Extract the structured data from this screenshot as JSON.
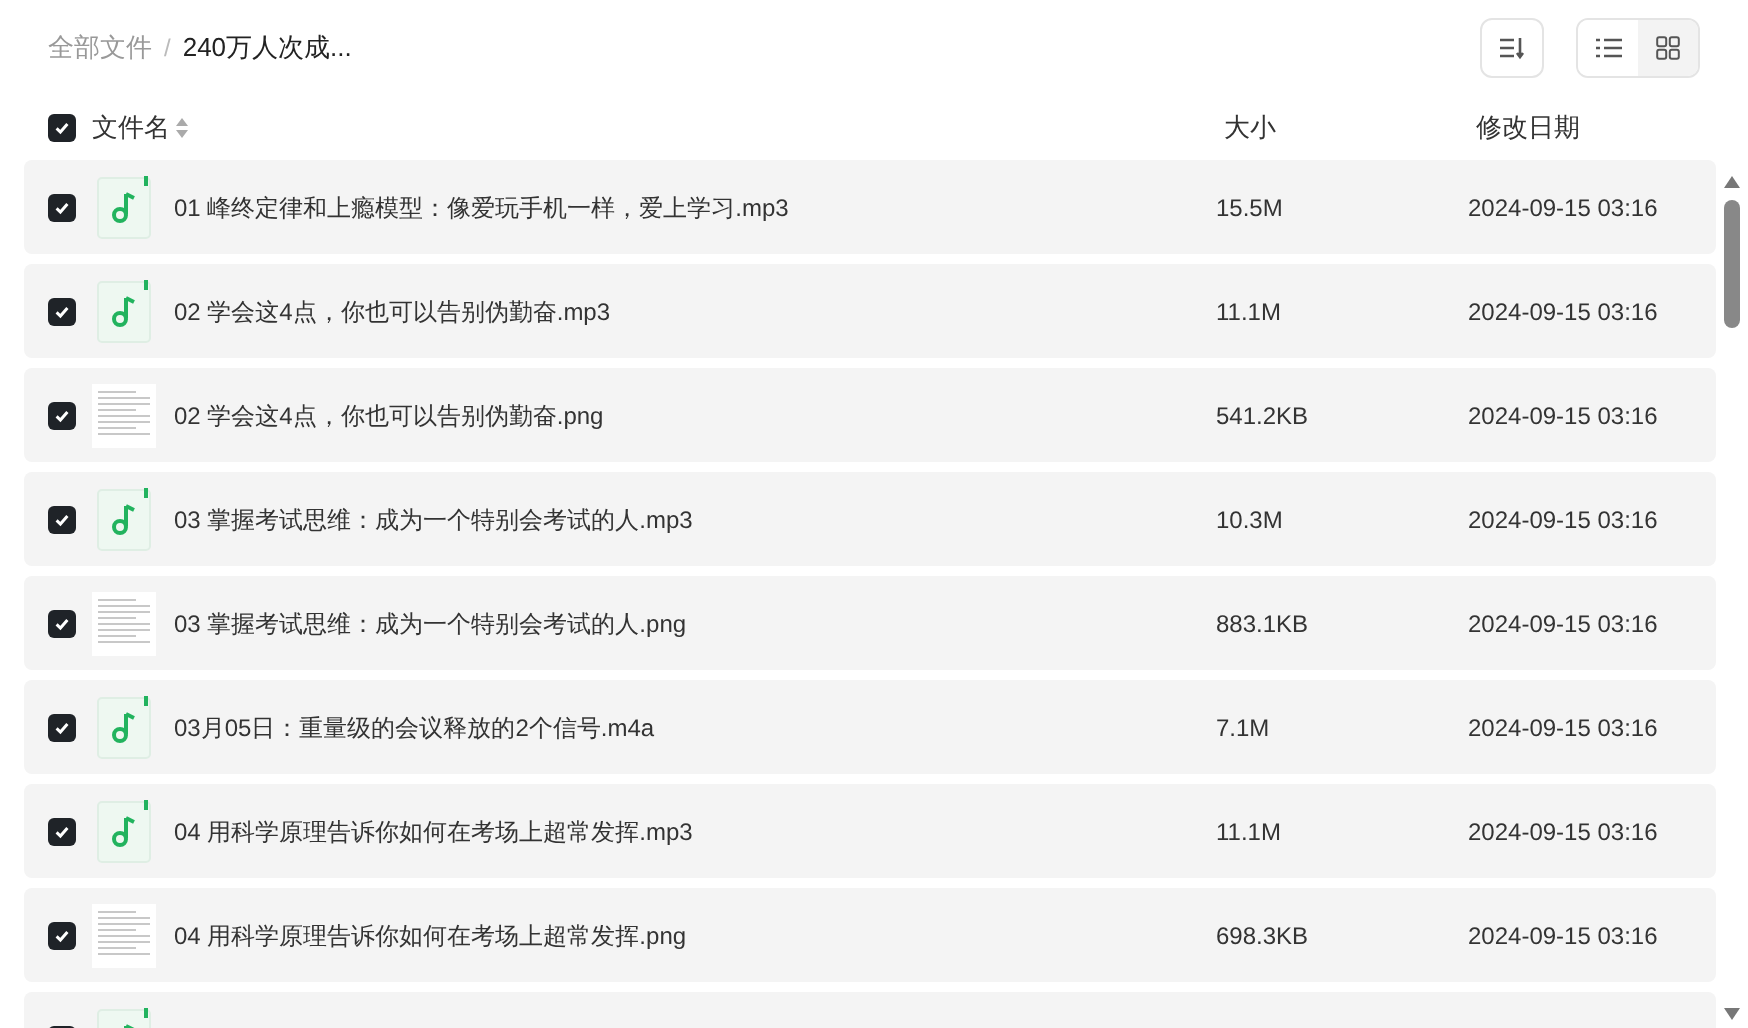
{
  "breadcrumb_separator": "/",
  "breadcrumb": [
    {
      "label": "全部文件",
      "current": false
    },
    {
      "label": "240万人次成...",
      "current": true
    }
  ],
  "view_toggle": [
    {
      "kind": "list",
      "selected": true
    },
    {
      "kind": "grid",
      "selected": false
    }
  ],
  "header": {
    "checked": true,
    "name": "文件名",
    "size": "大小",
    "date": "修改日期"
  },
  "rows": [
    {
      "kind": "audio",
      "checked": true,
      "name": "01 峰终定律和上瘾模型：像爱玩手机一样，爱上学习.mp3",
      "size": "15.5M",
      "date": "2024-09-15 03:16"
    },
    {
      "kind": "audio",
      "checked": true,
      "name": "02 学会这4点，你也可以告别伪勤奋.mp3",
      "size": "11.1M",
      "date": "2024-09-15 03:16"
    },
    {
      "kind": "image",
      "checked": true,
      "name": "02 学会这4点，你也可以告别伪勤奋.png",
      "size": "541.2KB",
      "date": "2024-09-15 03:16"
    },
    {
      "kind": "audio",
      "checked": true,
      "name": "03 掌握考试思维：成为一个特别会考试的人.mp3",
      "size": "10.3M",
      "date": "2024-09-15 03:16"
    },
    {
      "kind": "image",
      "checked": true,
      "name": "03 掌握考试思维：成为一个特别会考试的人.png",
      "size": "883.1KB",
      "date": "2024-09-15 03:16"
    },
    {
      "kind": "audio",
      "checked": true,
      "name": "03月05日：重量级的会议释放的2个信号.m4a",
      "size": "7.1M",
      "date": "2024-09-15 03:16"
    },
    {
      "kind": "audio",
      "checked": true,
      "name": "04 用科学原理告诉你如何在考场上超常发挥.mp3",
      "size": "11.1M",
      "date": "2024-09-15 03:16"
    },
    {
      "kind": "image",
      "checked": true,
      "name": "04 用科学原理告诉你如何在考场上超常发挥.png",
      "size": "698.3KB",
      "date": "2024-09-15 03:16"
    },
    {
      "kind": "audio",
      "checked": true
    }
  ]
}
